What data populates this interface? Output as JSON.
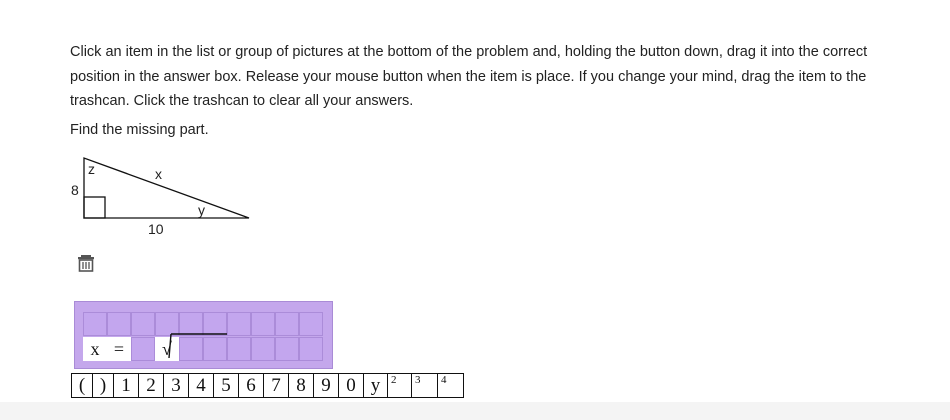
{
  "instructions": "Click an item in the list or group of pictures at the bottom of the problem and, holding the button down, drag it into the correct position in the answer box. Release your mouse button when the item is place. If you change your mind, drag the item to the trashcan. Click the trashcan to clear all your answers.",
  "prompt": "Find the missing part.",
  "figure": {
    "label_z": "z",
    "label_x": "x",
    "label_8": "8",
    "label_y": "y",
    "label_10": "10"
  },
  "trash": {
    "icon": "trashcan-icon"
  },
  "answer": {
    "var": "x",
    "equals": "=",
    "radical": "√"
  },
  "palette": {
    "tiles": [
      "(",
      ")",
      "1",
      "2",
      "3",
      "4",
      "5",
      "6",
      "7",
      "8",
      "9",
      "0",
      "y",
      "2",
      "3",
      "4"
    ]
  },
  "colors": {
    "answer_box": "#c4a7ec",
    "answer_cell": "#c3a6ee",
    "filled_cell": "#ffffff"
  }
}
